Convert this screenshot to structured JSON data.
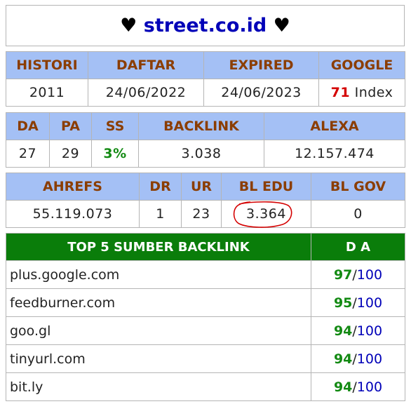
{
  "title": {
    "heart_left": "♥",
    "domain": "street.co.id",
    "heart_right": "♥"
  },
  "table1": {
    "headers": [
      "HISTORI",
      "DAFTAR",
      "EXPIRED",
      "GOOGLE"
    ],
    "histori": "2011",
    "daftar": "24/06/2022",
    "expired": "24/06/2023",
    "google_count": "71",
    "google_suffix": " Index"
  },
  "table2": {
    "headers": [
      "DA",
      "PA",
      "SS",
      "BACKLINK",
      "ALEXA"
    ],
    "da": "27",
    "pa": "29",
    "ss": "3%",
    "backlink": "3.038",
    "alexa": "12.157.474"
  },
  "table3": {
    "headers": [
      "AHREFS",
      "DR",
      "UR",
      "BL EDU",
      "BL GOV"
    ],
    "ahrefs": "55.119.073",
    "dr": "1",
    "ur": "23",
    "bl_edu": "3.364",
    "bl_gov": "0"
  },
  "table4": {
    "header_left": "TOP 5 SUMBER BACKLINK",
    "header_right": "D A",
    "rows": [
      {
        "site": "plus.google.com",
        "da": "97",
        "max": "100",
        "sep": "/"
      },
      {
        "site": "feedburner.com",
        "da": "95",
        "max": "100",
        "sep": "/"
      },
      {
        "site": "goo.gl",
        "da": "94",
        "max": "100",
        "sep": "/"
      },
      {
        "site": "tinyurl.com",
        "da": "94",
        "max": "100",
        "sep": "/"
      },
      {
        "site": "bit.ly",
        "da": "94",
        "max": "100",
        "sep": "/"
      }
    ]
  },
  "colors": {
    "header_bg": "#a4c0f5",
    "header_text": "#8b3d00",
    "green_header": "#0a7d0a",
    "title_blue": "#0000b8"
  }
}
